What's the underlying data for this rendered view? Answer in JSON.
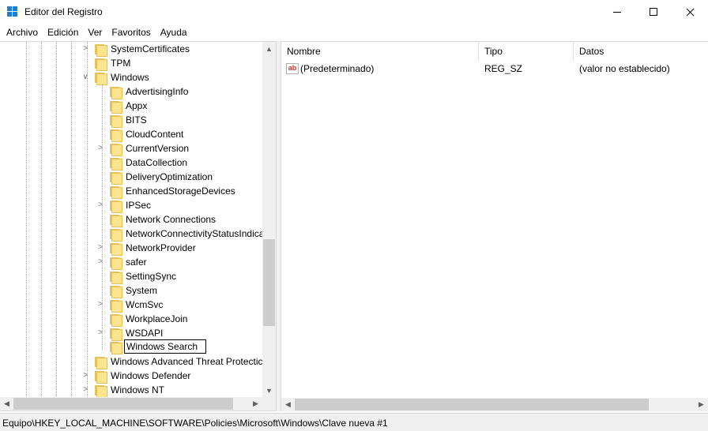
{
  "window": {
    "title": "Editor del Registro",
    "accent": "#1e7fd6"
  },
  "menu": [
    "Archivo",
    "Edición",
    "Ver",
    "Favoritos",
    "Ayuda"
  ],
  "tree": {
    "items": [
      {
        "label": "SystemCertificates",
        "expandable": true
      },
      {
        "label": "TPM",
        "expandable": false
      },
      {
        "label": "Windows",
        "expandable": true,
        "expanded": true
      },
      {
        "label": "AdvertisingInfo",
        "expandable": false
      },
      {
        "label": "Appx",
        "expandable": false
      },
      {
        "label": "BITS",
        "expandable": false
      },
      {
        "label": "CloudContent",
        "expandable": false
      },
      {
        "label": "CurrentVersion",
        "expandable": true
      },
      {
        "label": "DataCollection",
        "expandable": false
      },
      {
        "label": "DeliveryOptimization",
        "expandable": false
      },
      {
        "label": "EnhancedStorageDevices",
        "expandable": false
      },
      {
        "label": "IPSec",
        "expandable": true
      },
      {
        "label": "Network Connections",
        "expandable": false
      },
      {
        "label": "NetworkConnectivityStatusIndica",
        "expandable": false
      },
      {
        "label": "NetworkProvider",
        "expandable": true
      },
      {
        "label": "safer",
        "expandable": true
      },
      {
        "label": "SettingSync",
        "expandable": false
      },
      {
        "label": "System",
        "expandable": false
      },
      {
        "label": "WcmSvc",
        "expandable": true
      },
      {
        "label": "WorkplaceJoin",
        "expandable": false
      },
      {
        "label": "WSDAPI",
        "expandable": true
      },
      {
        "label": "Windows Search",
        "expandable": false,
        "editing": true
      },
      {
        "label": "Windows Advanced Threat Protectic",
        "expandable": false
      },
      {
        "label": "Windows Defender",
        "expandable": true
      },
      {
        "label": "Windows NT",
        "expandable": true
      }
    ]
  },
  "list": {
    "columns": [
      "Nombre",
      "Tipo",
      "Datos"
    ],
    "rows": [
      {
        "name": "(Predeterminado)",
        "type": "REG_SZ",
        "data": "(valor no establecido)",
        "icon": "string-value-icon"
      }
    ]
  },
  "status": {
    "path": "Equipo\\HKEY_LOCAL_MACHINE\\SOFTWARE\\Policies\\Microsoft\\Windows\\Clave nueva #1"
  }
}
